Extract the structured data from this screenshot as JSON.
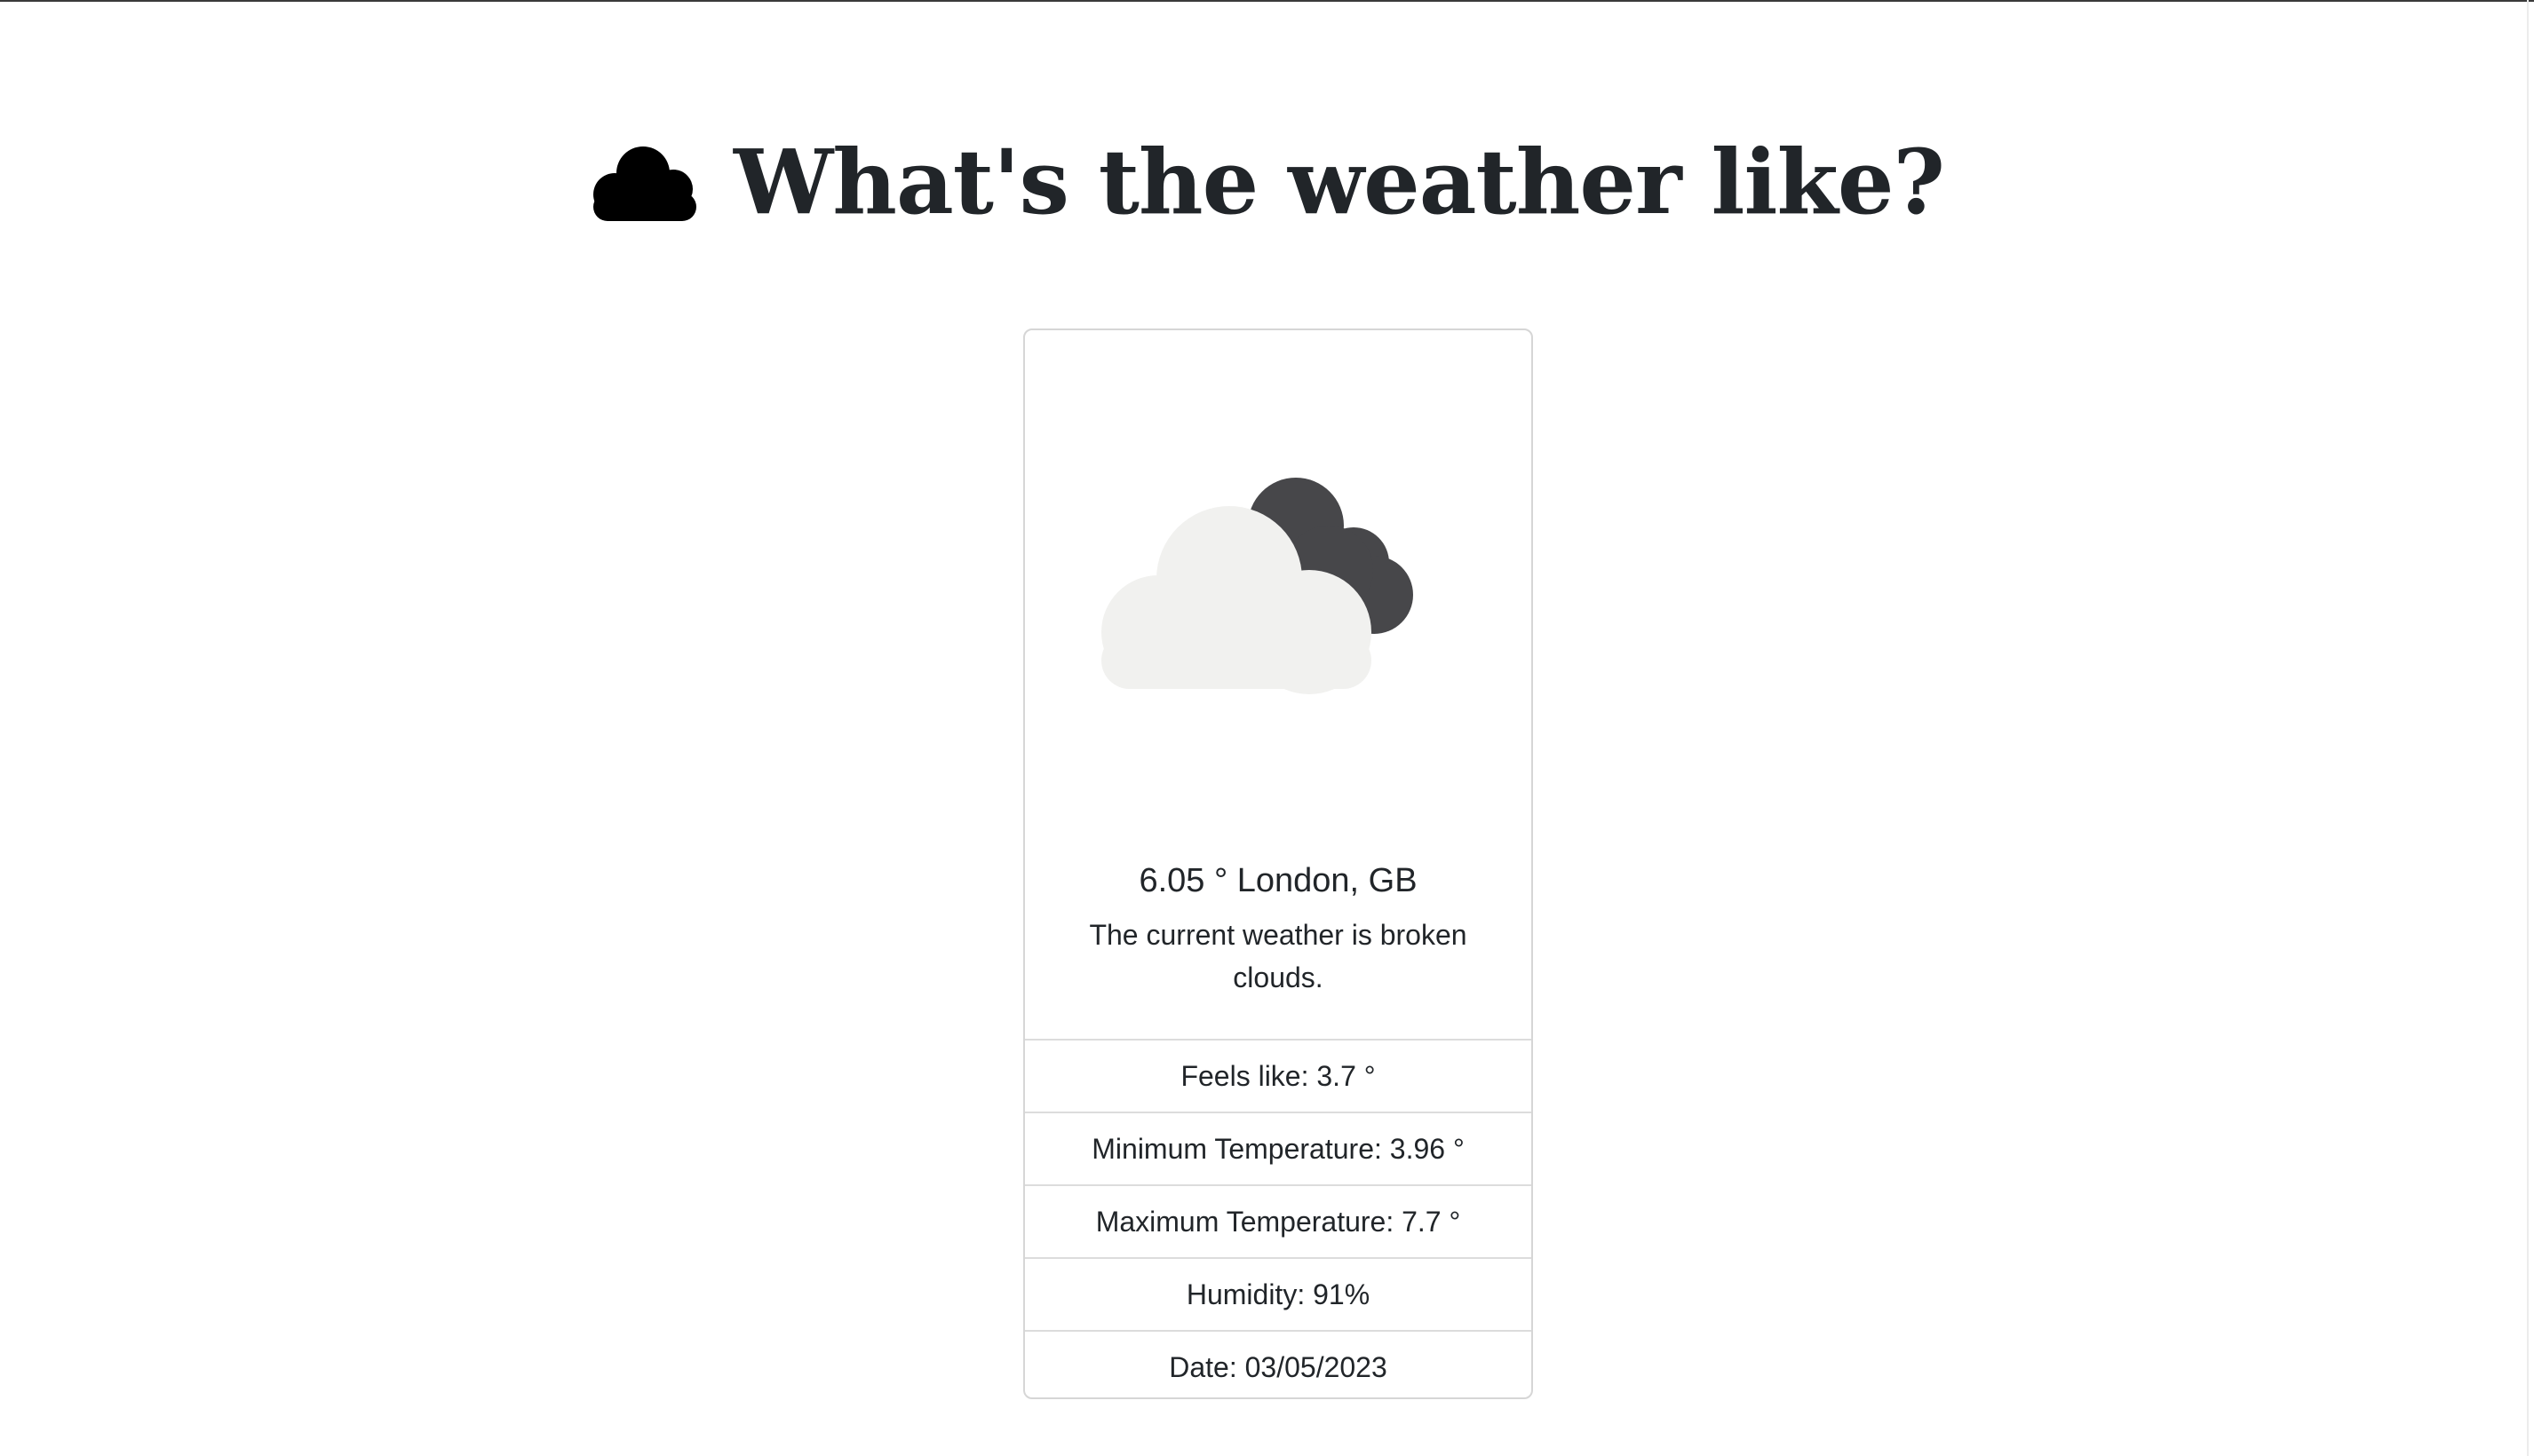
{
  "header": {
    "title": "What's the weather like?",
    "icon": "cloud-icon"
  },
  "weather": {
    "icon": "broken-clouds-icon",
    "title": "6.05 ° London, GB",
    "description": "The current weather is broken clouds."
  },
  "details": [
    {
      "label": "Feels like: 3.7 °"
    },
    {
      "label": "Minimum Temperature: 3.96 °"
    },
    {
      "label": "Maximum Temperature: 7.7 °"
    },
    {
      "label": "Humidity: 91%"
    },
    {
      "label": "Date: 03/05/2023"
    }
  ],
  "colors": {
    "text": "#212529",
    "light_cloud": "#f1f1ef",
    "dark_cloud": "#47474a",
    "border": "#d6d6d6"
  }
}
